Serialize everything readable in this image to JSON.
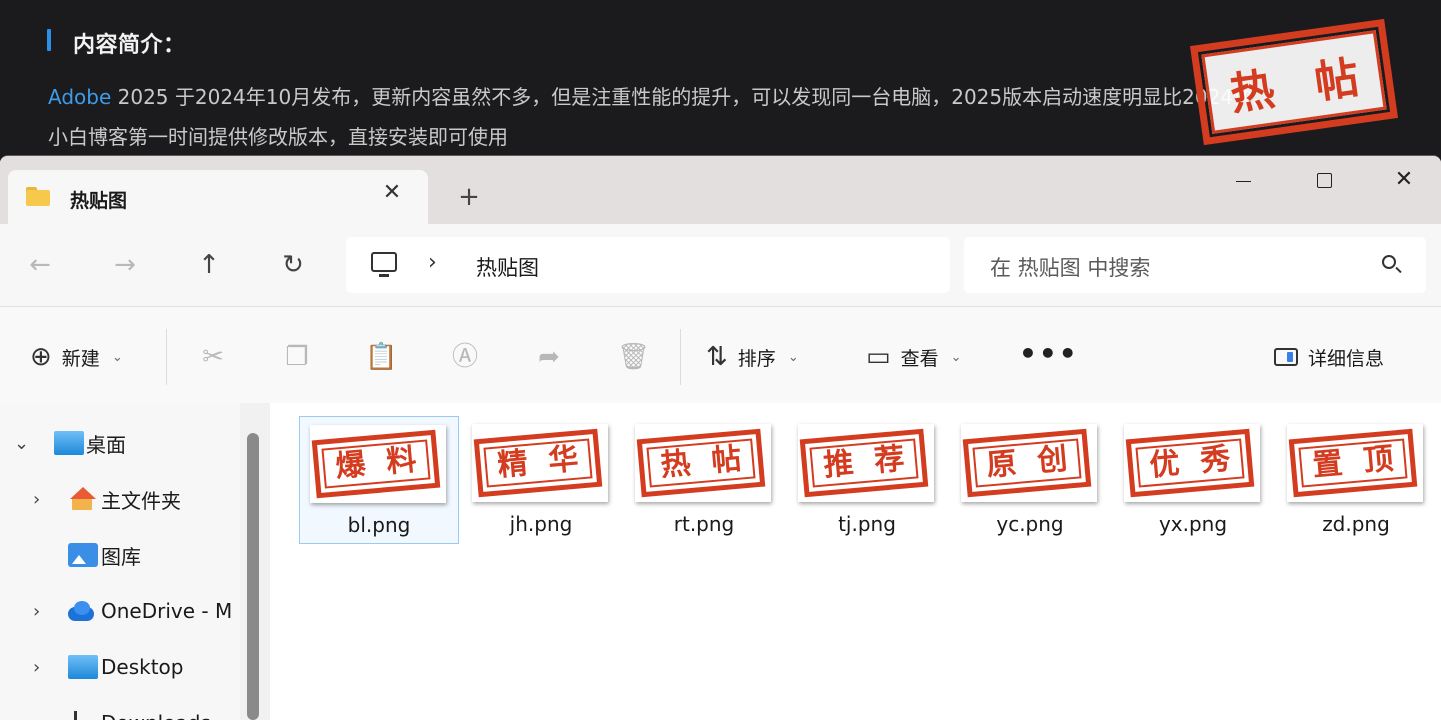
{
  "webpage": {
    "heading": "内容简介：",
    "para_link": "Adobe",
    "para_line1": " 2025 于2024年10月发布，更新内容虽然不多，但是注重性能的提升，可以发现同一台电脑，2025版本启动速度明显比2024快。",
    "para_line2": "小白博客第一时间提供修改版本，直接安装即可使用",
    "stamp_char1": "热",
    "stamp_char2": "帖"
  },
  "window": {
    "tab_title": "热贴图",
    "close_tab": "✕",
    "new_tab": "+",
    "win_close": "✕"
  },
  "nav": {
    "back": "←",
    "forward": "→",
    "up": "↑",
    "refresh": "↻",
    "chevron": "›",
    "path": "热贴图",
    "search_placeholder": "在 热贴图 中搜索"
  },
  "toolbar": {
    "new_label": "新建",
    "sort_label": "排序",
    "view_label": "查看",
    "more": "•••",
    "details_label": "详细信息"
  },
  "sidebar": {
    "items": [
      {
        "label": "桌面",
        "expander": "⌄"
      },
      {
        "label": "主文件夹",
        "expander": "›"
      },
      {
        "label": "图库",
        "expander": ""
      },
      {
        "label": "OneDrive - M",
        "expander": "›"
      },
      {
        "label": "Desktop",
        "expander": "›"
      },
      {
        "label": "Downloads",
        "expander": "›"
      }
    ]
  },
  "files": [
    {
      "name": "bl.png",
      "c1": "爆",
      "c2": "料"
    },
    {
      "name": "jh.png",
      "c1": "精",
      "c2": "华"
    },
    {
      "name": "rt.png",
      "c1": "热",
      "c2": "帖"
    },
    {
      "name": "tj.png",
      "c1": "推",
      "c2": "荐"
    },
    {
      "name": "yc.png",
      "c1": "原",
      "c2": "创"
    },
    {
      "name": "yx.png",
      "c1": "优",
      "c2": "秀"
    },
    {
      "name": "zd.png",
      "c1": "置",
      "c2": "顶"
    }
  ],
  "colors": {
    "accent": "#2f8fe6",
    "stamp_red": "#d43c20",
    "selection": "#9ccaf1"
  }
}
